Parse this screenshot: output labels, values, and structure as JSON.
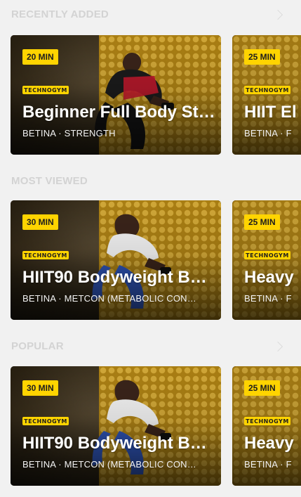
{
  "sections": [
    {
      "title": "RECENTLY ADDED",
      "has_chevron": true,
      "cards": [
        {
          "duration": "20 MIN",
          "brand": "TECHNOGYM",
          "title": "Beginner Full Body St…",
          "meta": "BETINA · STRENGTH"
        },
        {
          "duration": "25 MIN",
          "brand": "TECHNOGYM",
          "title": "HIIT El",
          "meta": "BETINA · F"
        }
      ]
    },
    {
      "title": "MOST VIEWED",
      "has_chevron": false,
      "cards": [
        {
          "duration": "30 MIN",
          "brand": "TECHNOGYM",
          "title": "HIIT90 Bodyweight B…",
          "meta": "BETINA · METCON (METABOLIC CON…"
        },
        {
          "duration": "25 MIN",
          "brand": "TECHNOGYM",
          "title": "Heavy",
          "meta": "BETINA · F"
        }
      ]
    },
    {
      "title": "POPULAR",
      "has_chevron": true,
      "cards": [
        {
          "duration": "30 MIN",
          "brand": "TECHNOGYM",
          "title": "HIIT90 Bodyweight B…",
          "meta": "BETINA · METCON (METABOLIC CON…"
        },
        {
          "duration": "25 MIN",
          "brand": "TECHNOGYM",
          "title": "Heavy",
          "meta": "BETINA · F"
        }
      ]
    }
  ],
  "colors": {
    "background": "#f1f1f1",
    "badge": "#ffd400",
    "section_title": "#d3d3d3"
  },
  "icons": {
    "chevron": "chevron-right-icon",
    "brand": "technogym-logo"
  }
}
